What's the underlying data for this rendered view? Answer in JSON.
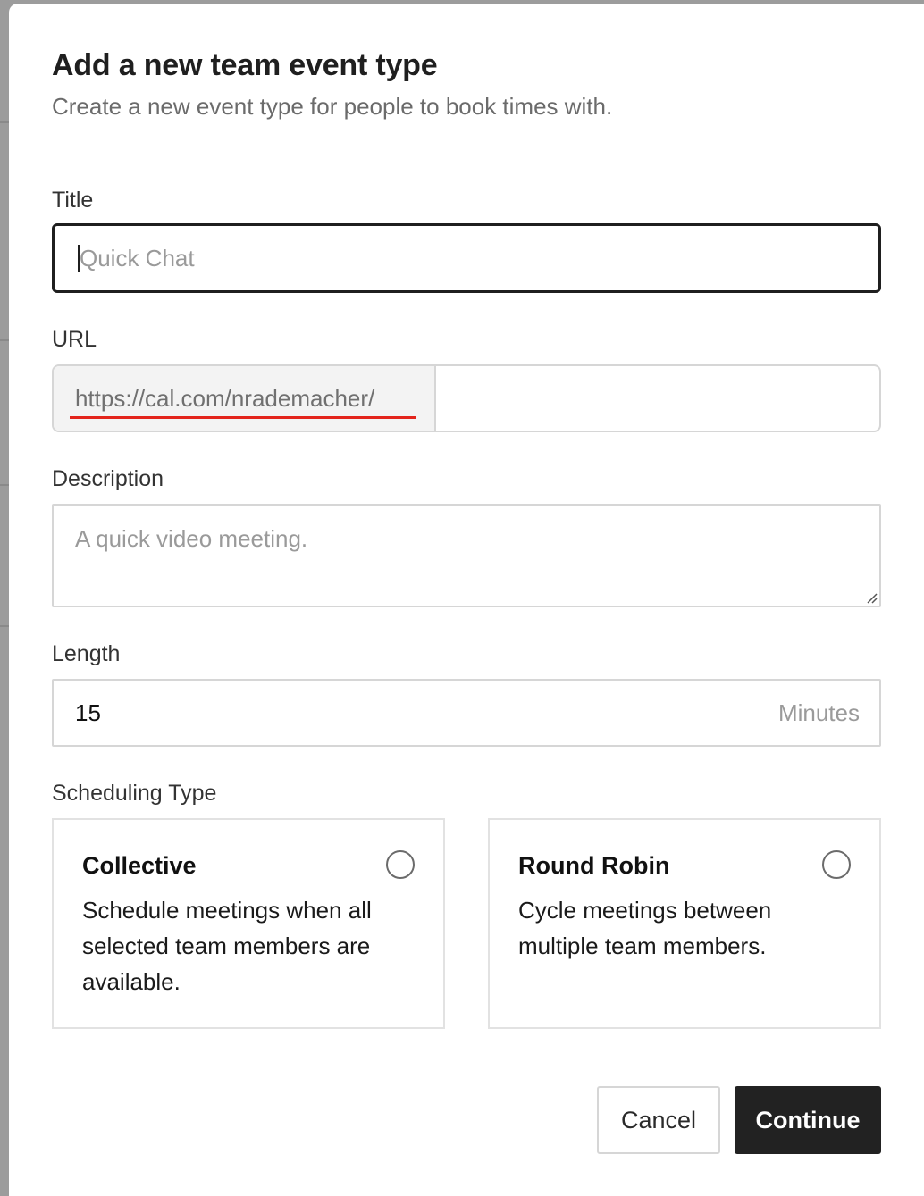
{
  "dialog": {
    "title": "Add a new team event type",
    "subtitle": "Create a new event type for people to book times with."
  },
  "form": {
    "title": {
      "label": "Title",
      "placeholder": "Quick Chat",
      "value": ""
    },
    "url": {
      "label": "URL",
      "prefix": "https://cal.com/nrademacher/",
      "value": ""
    },
    "description": {
      "label": "Description",
      "placeholder": "A quick video meeting.",
      "value": ""
    },
    "length": {
      "label": "Length",
      "value": "15",
      "unit": "Minutes"
    },
    "scheduling": {
      "label": "Scheduling Type",
      "options": [
        {
          "title": "Collective",
          "description": "Schedule meetings when all selected team members are available.",
          "selected": false
        },
        {
          "title": "Round Robin",
          "description": "Cycle meetings between multiple team members.",
          "selected": false
        }
      ]
    }
  },
  "actions": {
    "cancel_label": "Cancel",
    "continue_label": "Continue"
  },
  "colors": {
    "accent": "#222222",
    "url_highlight": "#e3241b",
    "backdrop": "#9c9c9c"
  }
}
